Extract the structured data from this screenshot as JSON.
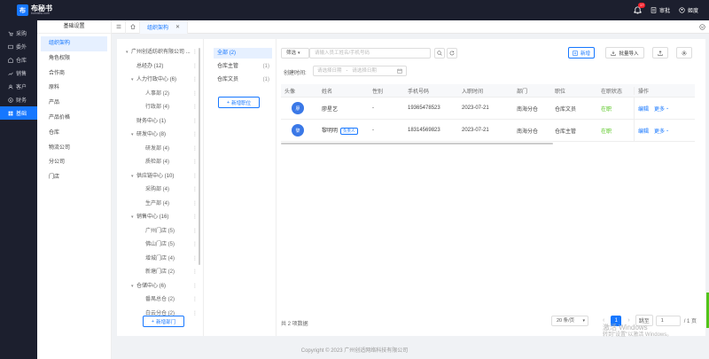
{
  "app": {
    "logo_mark": "布",
    "name": "布秘书",
    "subtitle": "bumishu.com"
  },
  "topbar": {
    "notification_count": "17",
    "review_label": "审批",
    "user_name": "姬度"
  },
  "sidebar": {
    "items": [
      {
        "label": "采购",
        "icon": "cart-icon"
      },
      {
        "label": "委外",
        "icon": "outsource-icon"
      },
      {
        "label": "仓库",
        "icon": "warehouse-icon"
      },
      {
        "label": "销售",
        "icon": "sales-icon"
      },
      {
        "label": "客户",
        "icon": "customer-icon"
      },
      {
        "label": "财务",
        "icon": "finance-icon"
      },
      {
        "label": "基础",
        "icon": "base-icon"
      }
    ]
  },
  "submenu": {
    "title": "基础设置",
    "items": [
      "组织架构",
      "角色权限",
      "合作商",
      "原料",
      "产品",
      "产品价格",
      "仓库",
      "物流公司",
      "分公司",
      "门店"
    ]
  },
  "tabs": [
    {
      "label": "组织架构"
    }
  ],
  "dept_tree": {
    "rows": [
      {
        "label": "广州创适纺织有限公司 ...",
        "caret": "▾",
        "indent": 0
      },
      {
        "label": "总经办 (12)",
        "caret": "",
        "indent": 1
      },
      {
        "label": "人力行政中心 (6)",
        "caret": "▾",
        "indent": 1
      },
      {
        "label": "人事部 (2)",
        "caret": "",
        "indent": 2
      },
      {
        "label": "行政部 (4)",
        "caret": "",
        "indent": 2
      },
      {
        "label": "财务中心 (1)",
        "caret": "",
        "indent": 1
      },
      {
        "label": "研发中心 (8)",
        "caret": "▾",
        "indent": 1
      },
      {
        "label": "研发部 (4)",
        "caret": "",
        "indent": 2
      },
      {
        "label": "质检部 (4)",
        "caret": "",
        "indent": 2
      },
      {
        "label": "供应链中心 (10)",
        "caret": "▾",
        "indent": 1
      },
      {
        "label": "采购部 (4)",
        "caret": "",
        "indent": 2
      },
      {
        "label": "生产部 (4)",
        "caret": "",
        "indent": 2
      },
      {
        "label": "销售中心 (16)",
        "caret": "▾",
        "indent": 1
      },
      {
        "label": "广州门店 (5)",
        "caret": "",
        "indent": 2
      },
      {
        "label": "佛山门店 (5)",
        "caret": "",
        "indent": 2
      },
      {
        "label": "增城门店 (4)",
        "caret": "",
        "indent": 2
      },
      {
        "label": "新塘门店 (2)",
        "caret": "",
        "indent": 2
      },
      {
        "label": "仓储中心 (6)",
        "caret": "▾",
        "indent": 1
      },
      {
        "label": "番禺总仓 (2)",
        "caret": "",
        "indent": 2
      },
      {
        "label": "白云分仓 (2)",
        "caret": "",
        "indent": 2
      }
    ],
    "add_label": "新增部门"
  },
  "positions": {
    "items": [
      {
        "label": "全部",
        "count": "(2)"
      },
      {
        "label": "仓库主管",
        "count": "(1)"
      },
      {
        "label": "仓库文员",
        "count": "(1)"
      }
    ],
    "add_label": "新增职位"
  },
  "filters": {
    "filter_label": "筛选",
    "search_placeholder": "请输入员工姓名/手机号码",
    "created_label": "创建时间:",
    "start_placeholder": "请选择日期",
    "separator": "-",
    "end_placeholder": "请选择日期"
  },
  "actions": {
    "add": "新增",
    "import": "批量导入"
  },
  "table": {
    "headers": [
      "头像",
      "姓名",
      "性别",
      "手机号码",
      "入职时间",
      "部门",
      "职位",
      "在职状态",
      "操作"
    ],
    "rows": [
      {
        "avatar": "廖",
        "name": "廖星艺",
        "tag": "",
        "gender": "-",
        "phone": "19365478523",
        "hire_date": "2023-07-21",
        "dept": "南海分仓",
        "position": "仓库文员",
        "status": "在职",
        "edit": "编辑",
        "more": "更多"
      },
      {
        "avatar": "黎",
        "name": "黎明明",
        "tag": "负责人",
        "gender": "-",
        "phone": "18314569823",
        "hire_date": "2023-07-21",
        "dept": "南海分仓",
        "position": "仓库主管",
        "status": "在职",
        "edit": "编辑",
        "more": "更多"
      }
    ]
  },
  "footer": {
    "total": "共 2 项数据",
    "page_size": "20 条/页",
    "current_page": "1",
    "jump_label": "跳至",
    "jump_value": "1",
    "page_total": "/ 1 页"
  },
  "copyright": "Copyright © 2023 广州创适网络科技有限公司",
  "watermark": {
    "line1": "激活 Windows",
    "line2": "转到\"设置\"以激活 Windows。"
  }
}
